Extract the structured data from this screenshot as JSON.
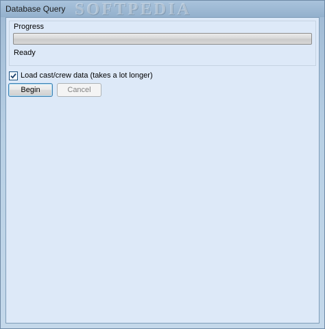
{
  "window": {
    "title": "Database Query",
    "watermark": "SOFTPEDIA"
  },
  "progress_group": {
    "label": "Progress",
    "progress_value": 0,
    "status": "Ready"
  },
  "options": {
    "load_cast_crew_label": "Load cast/crew data (takes a lot longer)",
    "load_cast_crew_checked": true
  },
  "buttons": {
    "begin_label": "Begin",
    "cancel_label": "Cancel",
    "cancel_enabled": false
  },
  "colors": {
    "client_background": "#dde9f8",
    "titlebar": "#9fb9d3",
    "focus_border": "#3c7fb1"
  }
}
